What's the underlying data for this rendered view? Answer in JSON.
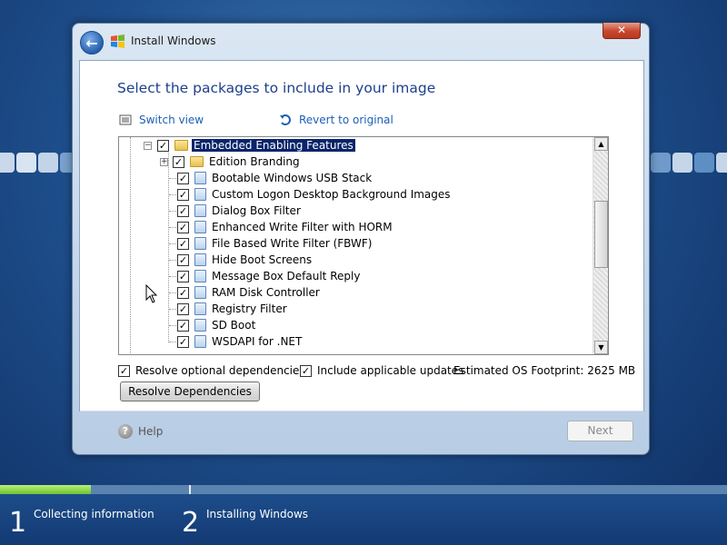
{
  "window": {
    "title": "Install Windows",
    "close_label": "✕",
    "back_label": "←"
  },
  "heading": "Select the packages to include in your image",
  "links": {
    "switch_view": "Switch view",
    "revert": "Revert to original"
  },
  "tree": {
    "root": {
      "label": "Embedded Enabling Features",
      "checked": true,
      "expanded": true
    },
    "items": [
      {
        "label": "Edition Branding",
        "type": "folder",
        "expander": "+"
      },
      {
        "label": "Bootable Windows USB Stack",
        "type": "package"
      },
      {
        "label": "Custom Logon Desktop Background Images",
        "type": "package"
      },
      {
        "label": "Dialog Box Filter",
        "type": "package"
      },
      {
        "label": "Enhanced Write Filter with HORM",
        "type": "package"
      },
      {
        "label": "File Based Write Filter (FBWF)",
        "type": "package"
      },
      {
        "label": "Hide Boot Screens",
        "type": "package"
      },
      {
        "label": "Message Box Default Reply",
        "type": "package"
      },
      {
        "label": "RAM Disk Controller",
        "type": "package"
      },
      {
        "label": "Registry Filter",
        "type": "package"
      },
      {
        "label": "SD Boot",
        "type": "package"
      },
      {
        "label": "WSDAPI for .NET",
        "type": "package"
      }
    ]
  },
  "options": {
    "resolve_optional": "Resolve optional dependencies",
    "include_updates": "Include applicable updates",
    "footprint": "Estimated OS Footprint: 2625 MB"
  },
  "buttons": {
    "resolve": "Resolve Dependencies",
    "next": "Next"
  },
  "help_label": "Help",
  "steps": [
    {
      "number": "1",
      "label": "Collecting information"
    },
    {
      "number": "2",
      "label": "Installing Windows"
    }
  ],
  "progress": {
    "fraction": 0.125
  },
  "colors": {
    "accent": "#1e3f8c",
    "selection": "#0a246a",
    "progress": "#6dc32e"
  }
}
